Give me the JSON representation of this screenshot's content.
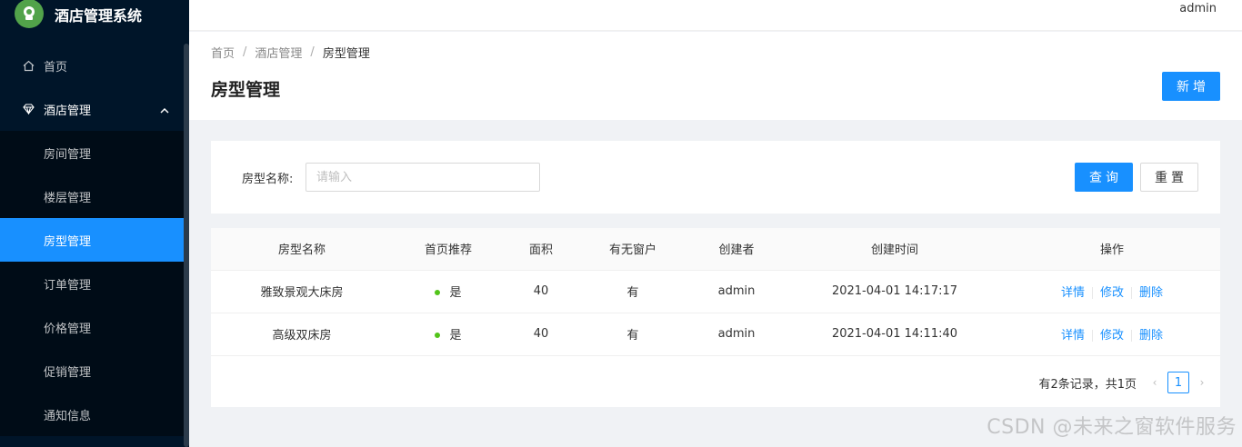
{
  "app": {
    "title": "酒店管理系统"
  },
  "header": {
    "user": "admin"
  },
  "sidebar": {
    "home": {
      "label": "首页",
      "icon": "home-icon"
    },
    "hotel": {
      "label": "酒店管理",
      "icon": "diamond-icon"
    },
    "sub_items": [
      {
        "label": "房间管理"
      },
      {
        "label": "楼层管理"
      },
      {
        "label": "房型管理",
        "active": true
      },
      {
        "label": "订单管理"
      },
      {
        "label": "价格管理"
      },
      {
        "label": "促销管理"
      },
      {
        "label": "通知信息"
      }
    ]
  },
  "breadcrumb": [
    "首页",
    "酒店管理",
    "房型管理"
  ],
  "page": {
    "title": "房型管理",
    "add_label": "新增"
  },
  "search": {
    "label": "房型名称:",
    "placeholder": "请输入",
    "query_label": "查询",
    "reset_label": "重置"
  },
  "table": {
    "columns": [
      "房型名称",
      "首页推荐",
      "面积",
      "有无窗户",
      "创建者",
      "创建时间",
      "操作"
    ],
    "rows": [
      {
        "name": "雅致景观大床房",
        "recommend": "是",
        "area": "40",
        "window": "有",
        "creator": "admin",
        "created": "2021-04-01 14:17:17"
      },
      {
        "name": "高级双床房",
        "recommend": "是",
        "area": "40",
        "window": "有",
        "creator": "admin",
        "created": "2021-04-01 14:11:40"
      }
    ],
    "actions": {
      "detail": "详情",
      "edit": "修改",
      "delete": "删除"
    }
  },
  "pagination": {
    "summary": "有2条记录，共1页",
    "current": "1"
  },
  "watermark": "CSDN @未来之窗软件服务",
  "colors": {
    "primary": "#1890ff",
    "sidebar_bg": "#001529",
    "status_dot": "#52c41a"
  }
}
